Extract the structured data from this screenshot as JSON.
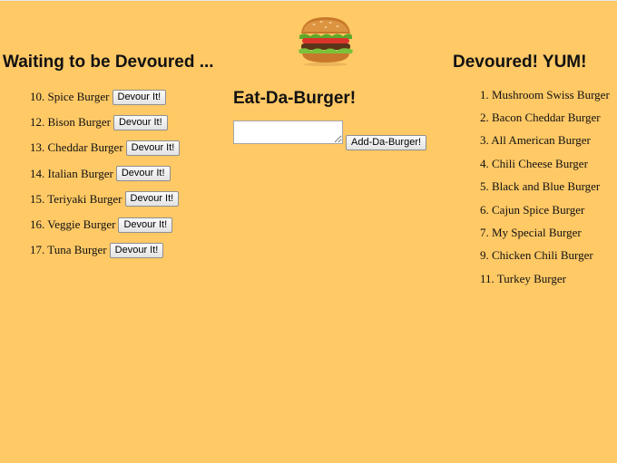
{
  "waiting": {
    "title": "Waiting to be Devoured ...",
    "items": [
      {
        "label": "10. Spice Burger",
        "button": "Devour It!"
      },
      {
        "label": "12. Bison Burger",
        "button": "Devour It!"
      },
      {
        "label": "13. Cheddar Burger",
        "button": "Devour It!"
      },
      {
        "label": "14. Italian Burger",
        "button": "Devour It!"
      },
      {
        "label": "15. Teriyaki Burger",
        "button": "Devour It!"
      },
      {
        "label": "16. Veggie Burger",
        "button": "Devour It!"
      },
      {
        "label": "17. Tuna Burger",
        "button": "Devour It!"
      }
    ]
  },
  "center": {
    "title": "Eat-Da-Burger!",
    "input_value": "",
    "add_button": "Add-Da-Burger!"
  },
  "devoured": {
    "title": "Devoured! YUM!",
    "items": [
      "1. Mushroom Swiss Burger",
      "2. Bacon Cheddar Burger",
      "3. All American Burger",
      "4. Chili Cheese Burger",
      "5. Black and Blue Burger",
      "6. Cajun Spice Burger",
      "7. My Special Burger",
      "9. Chicken Chili Burger",
      "11. Turkey Burger"
    ]
  },
  "colors": {
    "background": "#ffc966"
  },
  "logo_icon": "burger-icon"
}
